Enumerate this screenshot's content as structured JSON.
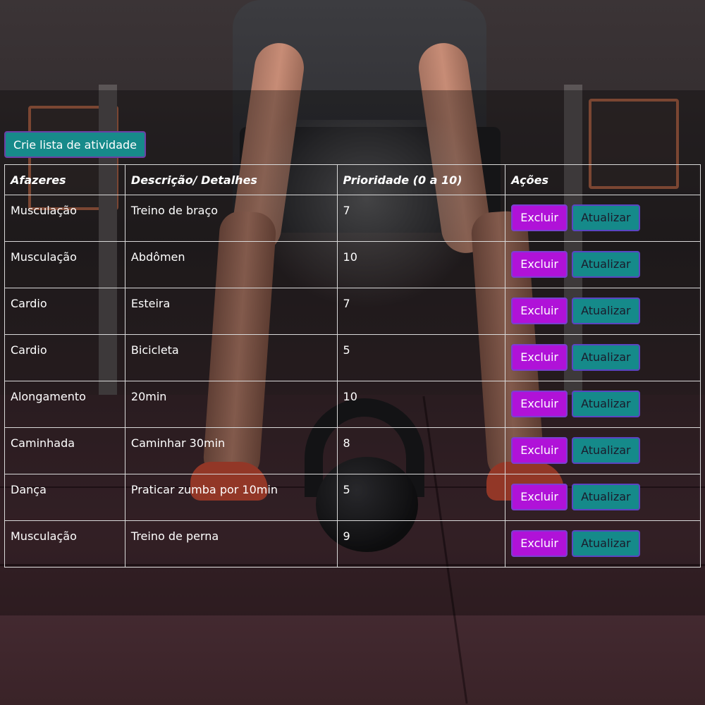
{
  "toolbar": {
    "create_label": "Crie lista de atividade"
  },
  "table": {
    "headers": [
      "Afazeres",
      "Descrição/ Detalhes",
      "Prioridade (0 a 10)",
      "Ações"
    ],
    "rows": [
      {
        "task": "Musculação",
        "description": "Treino de braço",
        "priority": "7"
      },
      {
        "task": "Musculação",
        "description": "Abdômen",
        "priority": "10"
      },
      {
        "task": "Cardio",
        "description": "Esteira",
        "priority": "7"
      },
      {
        "task": "Cardio",
        "description": "Bicicleta",
        "priority": "5"
      },
      {
        "task": "Alongamento",
        "description": "20min",
        "priority": "10"
      },
      {
        "task": "Caminhada",
        "description": "Caminhar 30min",
        "priority": "8"
      },
      {
        "task": "Dança",
        "description": "Praticar zumba por 10min",
        "priority": "5"
      },
      {
        "task": "Musculação",
        "description": "Treino de perna",
        "priority": "9"
      }
    ],
    "delete_label": "Excluir",
    "update_label": "Atualizar"
  },
  "colors": {
    "create_button": "#178a8a",
    "delete_button": "#b012d8",
    "update_button": "#158a8a",
    "table_border": "#d9d9d9"
  }
}
